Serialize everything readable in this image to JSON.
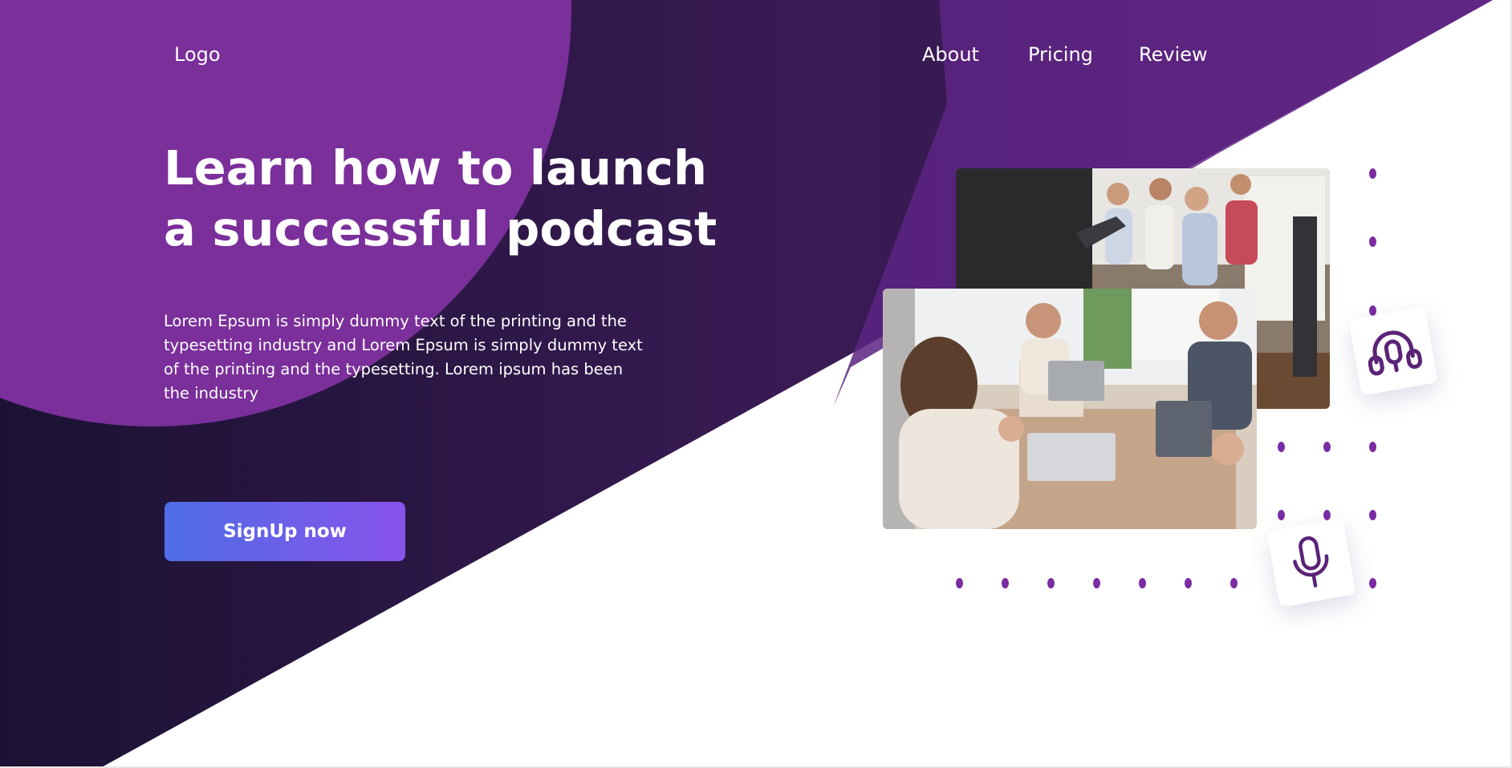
{
  "nav": {
    "logo": "Logo",
    "links": [
      {
        "label": "About"
      },
      {
        "label": "Pricing"
      },
      {
        "label": "Review"
      }
    ]
  },
  "hero": {
    "headline_line1": "Learn how to launch",
    "headline_line2": "a successful podcast",
    "description": "Lorem Epsum is simply dummy text of the printing and the typesetting industry and Lorem Epsum is simply dummy text of the printing and the typesetting. Lorem ipsum has been the industry",
    "cta_label": "SignUp now"
  },
  "images": {
    "back_photo": "audience-photo",
    "front_photo": "meeting-photo"
  },
  "icons": {
    "headphones": "headphones-icon",
    "microphone": "microphone-icon"
  },
  "colors": {
    "bg_dark": "#1b1233",
    "bg_mid": "#3a1b55",
    "bg_violet": "#5b2381",
    "blob": "#7a2f9a",
    "button_start": "#4f6de6",
    "button_end": "#8852ea",
    "dot": "#7a2ca3",
    "icon_stroke": "#5a2377"
  }
}
